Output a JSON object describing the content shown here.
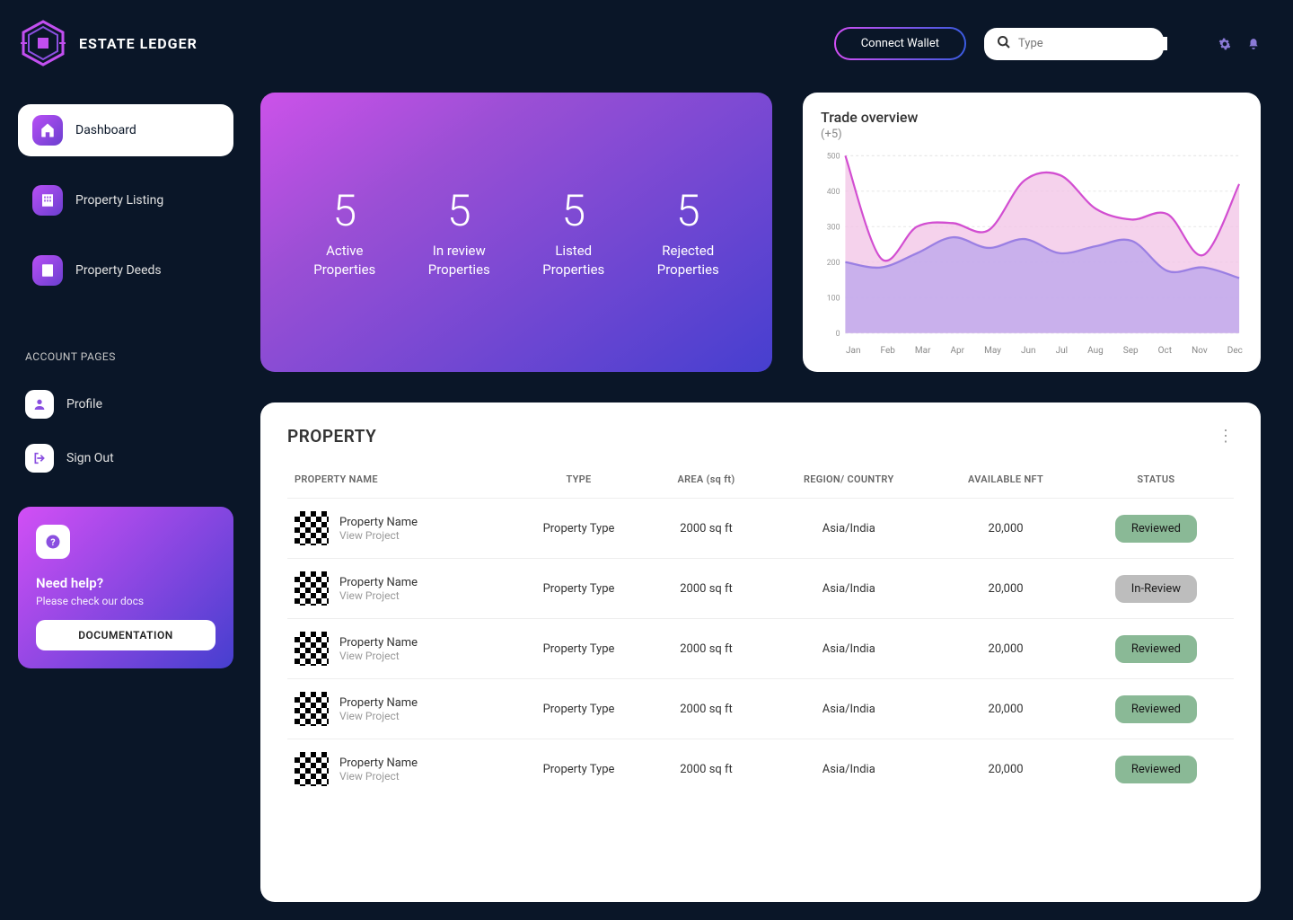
{
  "brand": {
    "name": "ESTATE LEDGER"
  },
  "topbar": {
    "connect_label": "Connect Wallet",
    "search_placeholder": "Type"
  },
  "sidebar": {
    "items": [
      {
        "label": "Dashboard",
        "active": true
      },
      {
        "label": "Property Listing",
        "active": false
      },
      {
        "label": "Property Deeds",
        "active": false
      }
    ],
    "account_header": "ACCOUNT PAGES",
    "account_items": [
      {
        "label": "Profile"
      },
      {
        "label": "Sign Out"
      }
    ],
    "help": {
      "title": "Need help?",
      "sub": "Please check our docs",
      "button": "DOCUMENTATION"
    }
  },
  "stats": [
    {
      "value": "5",
      "label1": "Active",
      "label2": "Properties"
    },
    {
      "value": "5",
      "label1": "In review",
      "label2": "Properties"
    },
    {
      "value": "5",
      "label1": "Listed",
      "label2": "Properties"
    },
    {
      "value": "5",
      "label1": "Rejected",
      "label2": "Properties"
    }
  ],
  "chart": {
    "title": "Trade overview",
    "subtitle": "(+5)"
  },
  "chart_data": {
    "type": "area",
    "x": [
      "Jan",
      "Feb",
      "Mar",
      "Apr",
      "May",
      "Jun",
      "Jul",
      "Aug",
      "Sep",
      "Oct",
      "Nov",
      "Dec"
    ],
    "ylim": [
      0,
      500
    ],
    "yticks": [
      0,
      100,
      200,
      300,
      400,
      500
    ],
    "series": [
      {
        "name": "series_pink",
        "color": "#d24ed1",
        "fill": "#f2c3e6",
        "values": [
          500,
          210,
          300,
          310,
          290,
          430,
          445,
          350,
          320,
          335,
          220,
          420
        ]
      },
      {
        "name": "series_purple",
        "color": "#9a7fe3",
        "fill": "#baa4ec",
        "values": [
          200,
          185,
          225,
          270,
          240,
          265,
          225,
          245,
          260,
          175,
          185,
          155
        ]
      }
    ]
  },
  "table": {
    "title": "PROPERTY",
    "headers": [
      "PROPERTY NAME",
      "TYPE",
      "AREA (sq ft)",
      "REGION/ COUNTRY",
      "AVAILABLE NFT",
      "STATUS"
    ],
    "view_label": "View Project",
    "rows": [
      {
        "name": "Property Name",
        "type": "Property Type",
        "area": "2000 sq ft",
        "region": "Asia/India",
        "nft": "20,000",
        "status": "Reviewed",
        "status_kind": "reviewed"
      },
      {
        "name": "Property Name",
        "type": "Property Type",
        "area": "2000 sq ft",
        "region": "Asia/India",
        "nft": "20,000",
        "status": "In-Review",
        "status_kind": "inreview"
      },
      {
        "name": "Property Name",
        "type": "Property Type",
        "area": "2000 sq ft",
        "region": "Asia/India",
        "nft": "20,000",
        "status": "Reviewed",
        "status_kind": "reviewed"
      },
      {
        "name": "Property Name",
        "type": "Property Type",
        "area": "2000 sq ft",
        "region": "Asia/India",
        "nft": "20,000",
        "status": "Reviewed",
        "status_kind": "reviewed"
      },
      {
        "name": "Property Name",
        "type": "Property Type",
        "area": "2000 sq ft",
        "region": "Asia/India",
        "nft": "20,000",
        "status": "Reviewed",
        "status_kind": "reviewed"
      }
    ]
  }
}
